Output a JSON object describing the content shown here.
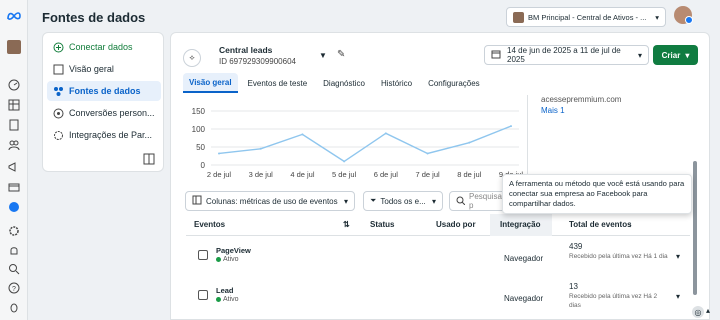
{
  "header": {
    "title": "Fontes de dados",
    "account": "BM Principal - Central de Ativos - ..."
  },
  "sidebar": {
    "items": [
      {
        "label": "Conectar dados"
      },
      {
        "label": "Visão geral"
      },
      {
        "label": "Fontes de dados"
      },
      {
        "label": "Conversões person..."
      },
      {
        "label": "Integrações de Par..."
      }
    ]
  },
  "source": {
    "name": "Central leads",
    "id": "ID 697929309900604"
  },
  "date_range": "14 de jun de 2025 a 11 de jul de 2025",
  "create_label": "Criar",
  "tabs": [
    {
      "label": "Visão geral"
    },
    {
      "label": "Eventos de teste"
    },
    {
      "label": "Diagnóstico"
    },
    {
      "label": "Histórico"
    },
    {
      "label": "Configurações"
    }
  ],
  "chart_data": {
    "type": "line",
    "categories": [
      "2 de jul",
      "3 de jul",
      "4 de jul",
      "5 de jul",
      "6 de jul",
      "7 de jul",
      "8 de jul",
      "9 de jul"
    ],
    "values": [
      32,
      45,
      85,
      10,
      88,
      32,
      62,
      108
    ],
    "ylim": [
      0,
      150
    ],
    "yticks": [
      "0",
      "50",
      "100",
      "150"
    ],
    "grid": true
  },
  "right_panel": {
    "site": "acessepremmium.com",
    "more": "Mais 1"
  },
  "filters": {
    "columns": "Colunas: métricas de uso de eventos",
    "all": "Todos os e...",
    "search_placeholder": "Pesquisar p"
  },
  "tooltip": "A ferramenta ou método que você está usando para conectar sua empresa ao Facebook para compartilhar dados.",
  "table": {
    "headers": {
      "events": "Eventos",
      "status": "Status",
      "used_by": "Usado por",
      "integration": "Integração",
      "total": "Total de eventos"
    },
    "rows": [
      {
        "event": "PageView",
        "status": "Ativo",
        "integration": "Navegador",
        "total": "439",
        "received": "Recebido pela última vez Há 1 dia"
      },
      {
        "event": "Lead",
        "status": "Ativo",
        "integration": "Navegador",
        "total": "13",
        "received": "Recebido pela última vez Há 2 dias"
      }
    ]
  }
}
